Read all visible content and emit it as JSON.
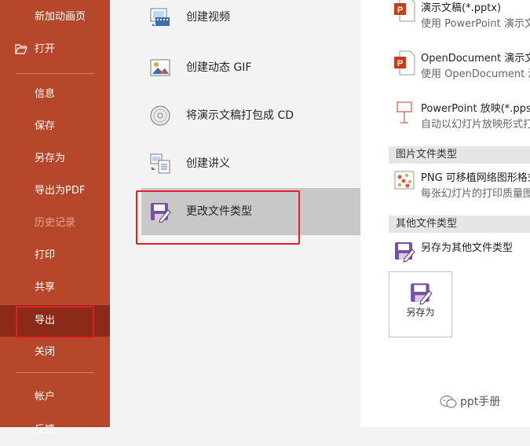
{
  "nav": {
    "new_animation_page": "新加动画页",
    "open": "打开",
    "info": "信息",
    "save": "保存",
    "save_as": "另存为",
    "export_pdf": "导出为PDF",
    "history": "历史记录",
    "print": "打印",
    "share": "共享",
    "export": "导出",
    "close": "关闭",
    "account": "帐户",
    "feedback": "反馈"
  },
  "export_options": {
    "create_video": "创建视频",
    "create_gif": "创建动态 GIF",
    "package_cd": "将演示文稿打包成 CD",
    "create_handouts": "创建讲义",
    "change_file_type": "更改文件类型"
  },
  "file_types": {
    "pptx_title": "演示文稿(*.pptx)",
    "pptx_desc": "使用 PowerPoint 演示文",
    "odp_title": "OpenDocument 演示文",
    "odp_desc": "使用 OpenDocument 演示",
    "ppsx_title": "PowerPoint 放映(*.ppsx",
    "ppsx_desc": "自动以幻灯片放映形式打",
    "image_section": "图片文件类型",
    "png_title": "PNG 可移植网络图形格式",
    "png_desc": "每张幻灯片的打印质量图",
    "other_section": "其他文件类型",
    "other_title": "另存为其他文件类型",
    "save_as_button": "另存为"
  },
  "watermark": "ppt手册",
  "colors": {
    "accent": "#b7472a",
    "accent_dark": "#8b2a16",
    "highlight": "#e0202a"
  }
}
